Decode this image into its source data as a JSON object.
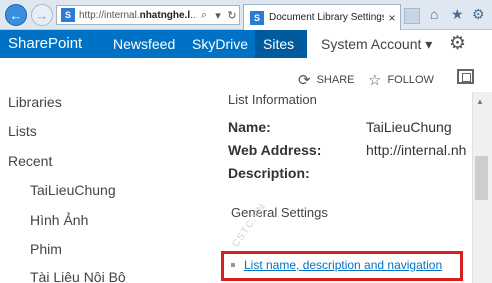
{
  "browser": {
    "address_url_plain": "http://internal.",
    "address_url_bold": "nhatnghe.l",
    "address_url_tail": "...",
    "search_glyph": "⌕",
    "dropdown_glyph": "▾",
    "refresh_glyph": "↻",
    "tab_title": "Document Library Settings",
    "tab_close_glyph": "×",
    "site_icon_glyph": "S",
    "back_glyph": "←",
    "forward_glyph": "→",
    "home_glyph": "⌂",
    "star_glyph": "★",
    "tools_glyph": "⚙"
  },
  "suitebar": {
    "brand": "SharePoint",
    "links": [
      "Newsfeed",
      "SkyDrive",
      "Sites"
    ],
    "account": "System Account",
    "account_caret": "▾",
    "gear_glyph": "⚙"
  },
  "actions": {
    "share_label": "SHARE",
    "follow_label": "FOLLOW",
    "share_glyph": "⟳",
    "follow_glyph": "☆"
  },
  "leftnav": {
    "items": [
      "Libraries",
      "Lists",
      "Recent"
    ],
    "recent_items": [
      "TaiLieuChung",
      "Hình Ảnh",
      "Phim",
      "Tài Liệu Nội Bộ"
    ]
  },
  "main": {
    "list_info_title": "List Information",
    "name_label": "Name:",
    "name_value": "TaiLieuChung",
    "web_address_label": "Web Address:",
    "web_address_value": "http://internal.nh",
    "description_label": "Description:",
    "general_settings_title": "General Settings",
    "general_link": "List name, description and navigation",
    "watermark": "CSTC.VN"
  },
  "colors": {
    "brand_blue": "#0072c6",
    "sites_active": "#005a9e",
    "highlight_red": "#d62020"
  },
  "icons": [
    "back-icon",
    "forward-icon",
    "site-icon",
    "search-icon",
    "refresh-icon",
    "close-icon",
    "home-icon",
    "star-icon",
    "gear-icon",
    "share-icon",
    "follow-icon",
    "focus-icon"
  ]
}
